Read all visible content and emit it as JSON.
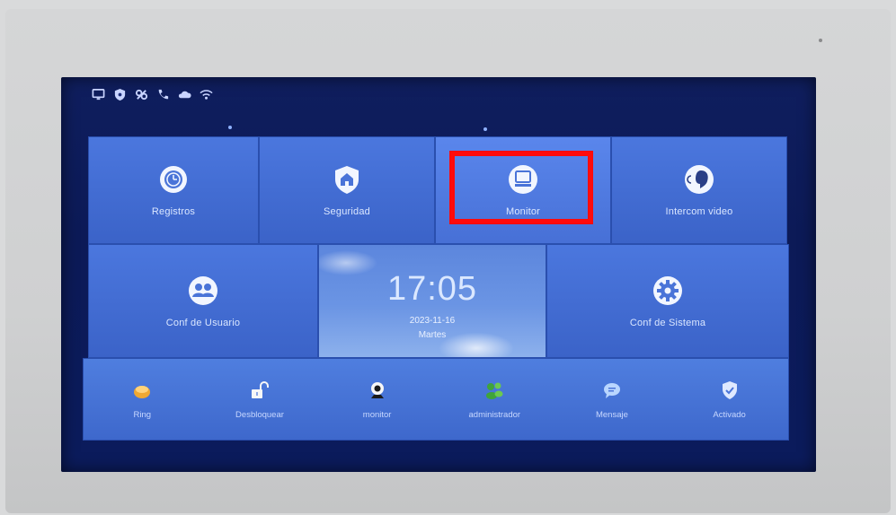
{
  "status_icons": [
    "monitor-icon",
    "shield-icon",
    "link-icon",
    "phone-icon",
    "cloud-icon",
    "wifi-icon"
  ],
  "tiles_row1": [
    {
      "name": "registros",
      "label": "Registros",
      "icon": "record-icon"
    },
    {
      "name": "seguridad",
      "label": "Seguridad",
      "icon": "home-shield-icon"
    },
    {
      "name": "monitor",
      "label": "Monitor",
      "icon": "monitor-screen-icon",
      "selected": true
    },
    {
      "name": "intercom-video",
      "label": "Intercom video",
      "icon": "speaker-icon"
    }
  ],
  "tiles_row2": {
    "user_settings": {
      "label": "Conf de Usuario",
      "icon": "users-icon"
    },
    "clock": {
      "time": "17:05",
      "date": "2023-11-16",
      "day": "Martes"
    },
    "system_settings": {
      "label": "Conf de Sistema",
      "icon": "gear-icon"
    }
  },
  "bottom_bar": [
    {
      "name": "ring",
      "label": "Ring",
      "icon": "ring-icon"
    },
    {
      "name": "desbloquear",
      "label": "Desbloquear",
      "icon": "unlock-icon"
    },
    {
      "name": "monitor",
      "label": "monitor",
      "icon": "camera-icon"
    },
    {
      "name": "administrador",
      "label": "administrador",
      "icon": "admin-icon"
    },
    {
      "name": "mensaje",
      "label": "Mensaje",
      "icon": "message-icon"
    },
    {
      "name": "activado",
      "label": "Activado",
      "icon": "shield-check-icon"
    }
  ],
  "colors": {
    "tile": "#4b77de",
    "highlight": "#ff0b0b",
    "screen": "#0f1e5e"
  }
}
